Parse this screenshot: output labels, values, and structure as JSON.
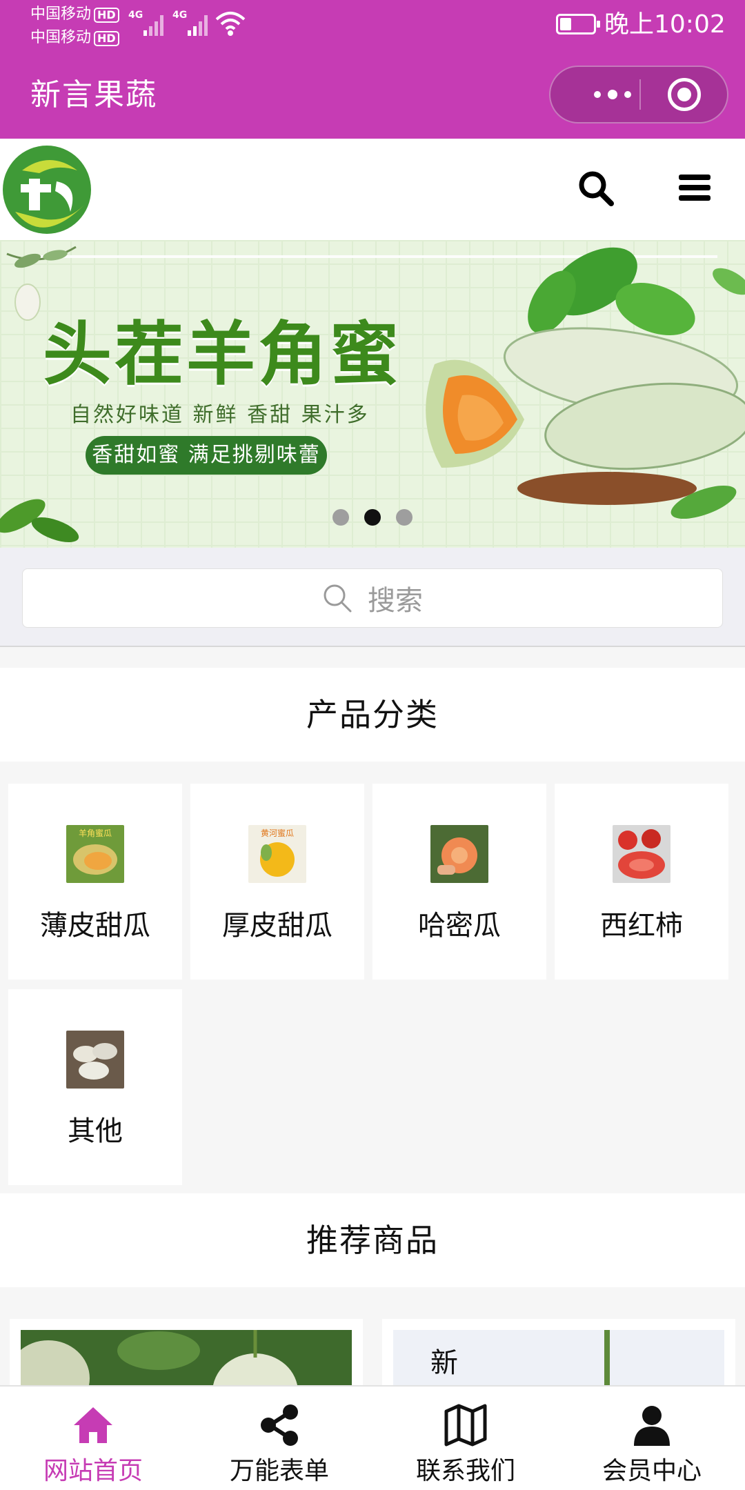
{
  "status_bar": {
    "carrier1": "中国移动",
    "carrier2": "中国移动",
    "hd": "HD",
    "net": "4G",
    "time": "晚上10:02",
    "battery_level": 0.3
  },
  "title_bar": {
    "title": "新言果蔬"
  },
  "banner": {
    "title": "头茬羊角蜜",
    "subtitle": "自然好味道 新鲜 香甜 果汁多",
    "tagline": "香甜如蜜 满足挑剔味蕾",
    "slide_count": 3,
    "active_slide": 2
  },
  "search": {
    "placeholder": "搜索"
  },
  "categories": {
    "title": "产品分类",
    "items": [
      {
        "label": "薄皮甜瓜",
        "thumb_label": "羊角蜜瓜"
      },
      {
        "label": "厚皮甜瓜",
        "thumb_label": "黄河蜜瓜"
      },
      {
        "label": "哈密瓜"
      },
      {
        "label": "西红柿"
      },
      {
        "label": "其他"
      }
    ]
  },
  "recommended": {
    "title": "推荐商品",
    "product2_text": "新"
  },
  "tabbar": {
    "items": [
      {
        "label": "网站首页",
        "icon": "home-icon",
        "active": true
      },
      {
        "label": "万能表单",
        "icon": "share-icon",
        "active": false
      },
      {
        "label": "联系我们",
        "icon": "map-icon",
        "active": false
      },
      {
        "label": "会员中心",
        "icon": "user-icon",
        "active": false
      }
    ]
  },
  "colors": {
    "brand": "#c63cb4",
    "banner_green": "#3d8a1c"
  }
}
